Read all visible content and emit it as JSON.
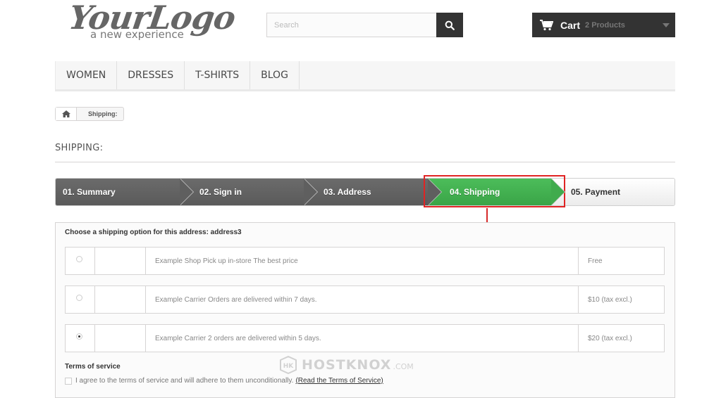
{
  "header": {
    "logo_main": "YourLogo",
    "logo_sub": "a new experience",
    "search_placeholder": "Search",
    "search_icon": "search-icon",
    "cart_label": "Cart",
    "cart_count": "2 Products"
  },
  "menu": {
    "items": [
      {
        "label": "WOMEN"
      },
      {
        "label": "DRESSES"
      },
      {
        "label": "T-SHIRTS"
      },
      {
        "label": "BLOG"
      }
    ]
  },
  "breadcrumb": {
    "home_icon": "home-icon",
    "current": "Shipping:"
  },
  "page": {
    "title": "SHIPPING:"
  },
  "steps": [
    {
      "label": "01. Summary",
      "state": "done"
    },
    {
      "label": "02. Sign in",
      "state": "done"
    },
    {
      "label": "03. Address",
      "state": "done"
    },
    {
      "label": "04. Shipping",
      "state": "current"
    },
    {
      "label": "05. Payment",
      "state": "next"
    }
  ],
  "shipping": {
    "heading": "Choose a shipping option for this address: address3",
    "options": [
      {
        "description": "Example Shop Pick up in-store The best price",
        "price": "Free",
        "selected": false
      },
      {
        "description": "Example Carrier Orders are delivered within 7 days.",
        "price": "$10 (tax excl.)",
        "selected": false
      },
      {
        "description": "Example Carrier 2 orders are delivered within 5 days.",
        "price": "$20 (tax excl.)",
        "selected": true
      }
    ]
  },
  "terms": {
    "heading": "Terms of service",
    "agree_text": "I agree to the terms of service and will adhere to them unconditionally.",
    "link_text": "(Read the Terms of Service)"
  },
  "watermark": {
    "text": "HOSTKNOX",
    "domain": ".COM"
  },
  "colors": {
    "current_step": "#45b352",
    "highlight": "#e02424",
    "dark": "#333333"
  }
}
